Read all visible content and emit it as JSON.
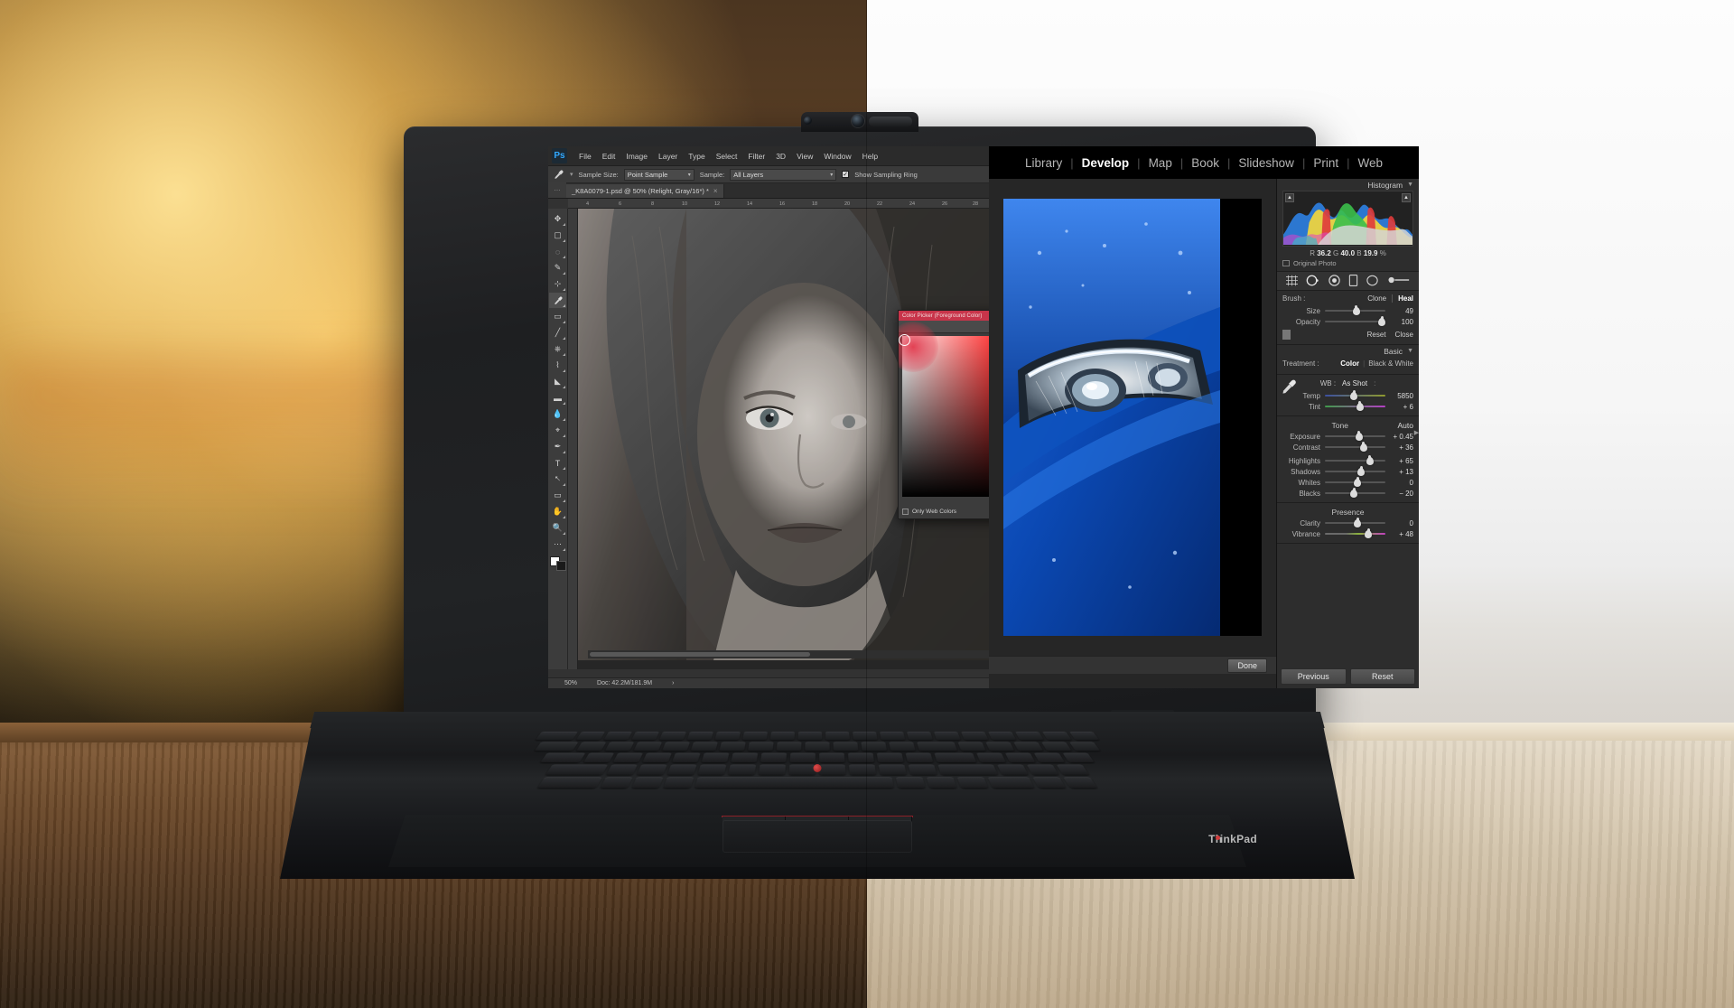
{
  "photoshop": {
    "app_logo": "Ps",
    "menus": [
      "File",
      "Edit",
      "Image",
      "Layer",
      "Type",
      "Select",
      "Filter",
      "3D",
      "View",
      "Window",
      "Help"
    ],
    "options_bar": {
      "tool_icon": "eyedropper-icon",
      "sample_size_label": "Sample Size:",
      "sample_size_value": "Point Sample",
      "sample_label": "Sample:",
      "sample_value": "All Layers",
      "show_sampling_ring_label": "Show Sampling Ring",
      "show_sampling_ring_checked": "✓"
    },
    "document_tab": "_K8A0079-1.psd @ 50% (Relight, Gray/16*) *",
    "tab_close": "×",
    "ruler_ticks": [
      "4",
      "6",
      "8",
      "10",
      "12",
      "14",
      "16",
      "18",
      "20",
      "22",
      "24",
      "26",
      "28"
    ],
    "tools": [
      "move-tool",
      "marquee-tool",
      "lasso-tool",
      "quick-select-tool",
      "crop-tool",
      "eyedropper-tool",
      "healing-brush-tool",
      "brush-tool",
      "clone-stamp-tool",
      "history-brush-tool",
      "eraser-tool",
      "gradient-tool",
      "blur-tool",
      "dodge-tool",
      "pen-tool",
      "type-tool",
      "path-select-tool",
      "shape-tool",
      "hand-tool",
      "zoom-tool",
      "more-tools"
    ],
    "status_bar": {
      "zoom": "50%",
      "doc_info": "Doc: 42.2M/181.9M",
      "arrow": "›"
    },
    "color_picker": {
      "title": "Color Picker (Foreground Color)",
      "only_web_colors": "Only Web Colors",
      "accent": "#c8344a"
    }
  },
  "lightroom": {
    "modules": [
      {
        "label": "Library",
        "active": false
      },
      {
        "label": "Develop",
        "active": true
      },
      {
        "label": "Map",
        "active": false
      },
      {
        "label": "Book",
        "active": false
      },
      {
        "label": "Slideshow",
        "active": false
      },
      {
        "label": "Print",
        "active": false
      },
      {
        "label": "Web",
        "active": false
      }
    ],
    "module_separator": "|",
    "histogram": {
      "title": "Histogram",
      "collapse": "▼",
      "r_label": "R",
      "r_value": "36.2",
      "g_label": "G",
      "g_value": "40.0",
      "b_label": "B",
      "b_value": "19.9",
      "percent": "%",
      "original_photo": "Original Photo",
      "clip_arrow": "▲"
    },
    "tool_strip": [
      "crop-overlay-icon",
      "spot-removal-icon",
      "red-eye-icon",
      "graduated-filter-icon",
      "radial-filter-icon",
      "adjustment-brush-icon"
    ],
    "brush_panel": {
      "brush_label": "Brush :",
      "clone_label": "Clone",
      "heal_label": "Heal",
      "size_label": "Size",
      "size_value": "49",
      "opacity_label": "Opacity",
      "opacity_value": "100",
      "reset_label": "Reset",
      "close_label": "Close"
    },
    "basic_panel": {
      "title": "Basic",
      "collapse": "▼",
      "treatment_label": "Treatment :",
      "treatment_color": "Color",
      "treatment_bw": "Black & White",
      "wb_label": "WB :",
      "wb_value": "As Shot",
      "wb_colon": ":",
      "eyedropper": "wb-eyedropper-icon",
      "temp_label": "Temp",
      "temp_value": "5850",
      "tint_label": "Tint",
      "tint_value": "+ 6",
      "tone_title": "Tone",
      "auto_label": "Auto",
      "exposure_label": "Exposure",
      "exposure_value": "+ 0.45",
      "contrast_label": "Contrast",
      "contrast_value": "+ 36",
      "highlights_label": "Highlights",
      "highlights_value": "+ 65",
      "shadows_label": "Shadows",
      "shadows_value": "+ 13",
      "whites_label": "Whites",
      "whites_value": "0",
      "blacks_label": "Blacks",
      "blacks_value": "− 20",
      "presence_title": "Presence",
      "clarity_label": "Clarity",
      "clarity_value": "0",
      "vibrance_label": "Vibrance",
      "vibrance_value": "+ 48"
    },
    "toolbar": {
      "done_label": "Done"
    },
    "bottom_buttons": {
      "previous_label": "Previous",
      "reset_label": "Reset"
    },
    "panel_arrow": "▶"
  },
  "laptop": {
    "brand_logo": "ThinkPad",
    "webcam": "webcam-icon",
    "privacy_shutter": "privacy-shutter"
  }
}
